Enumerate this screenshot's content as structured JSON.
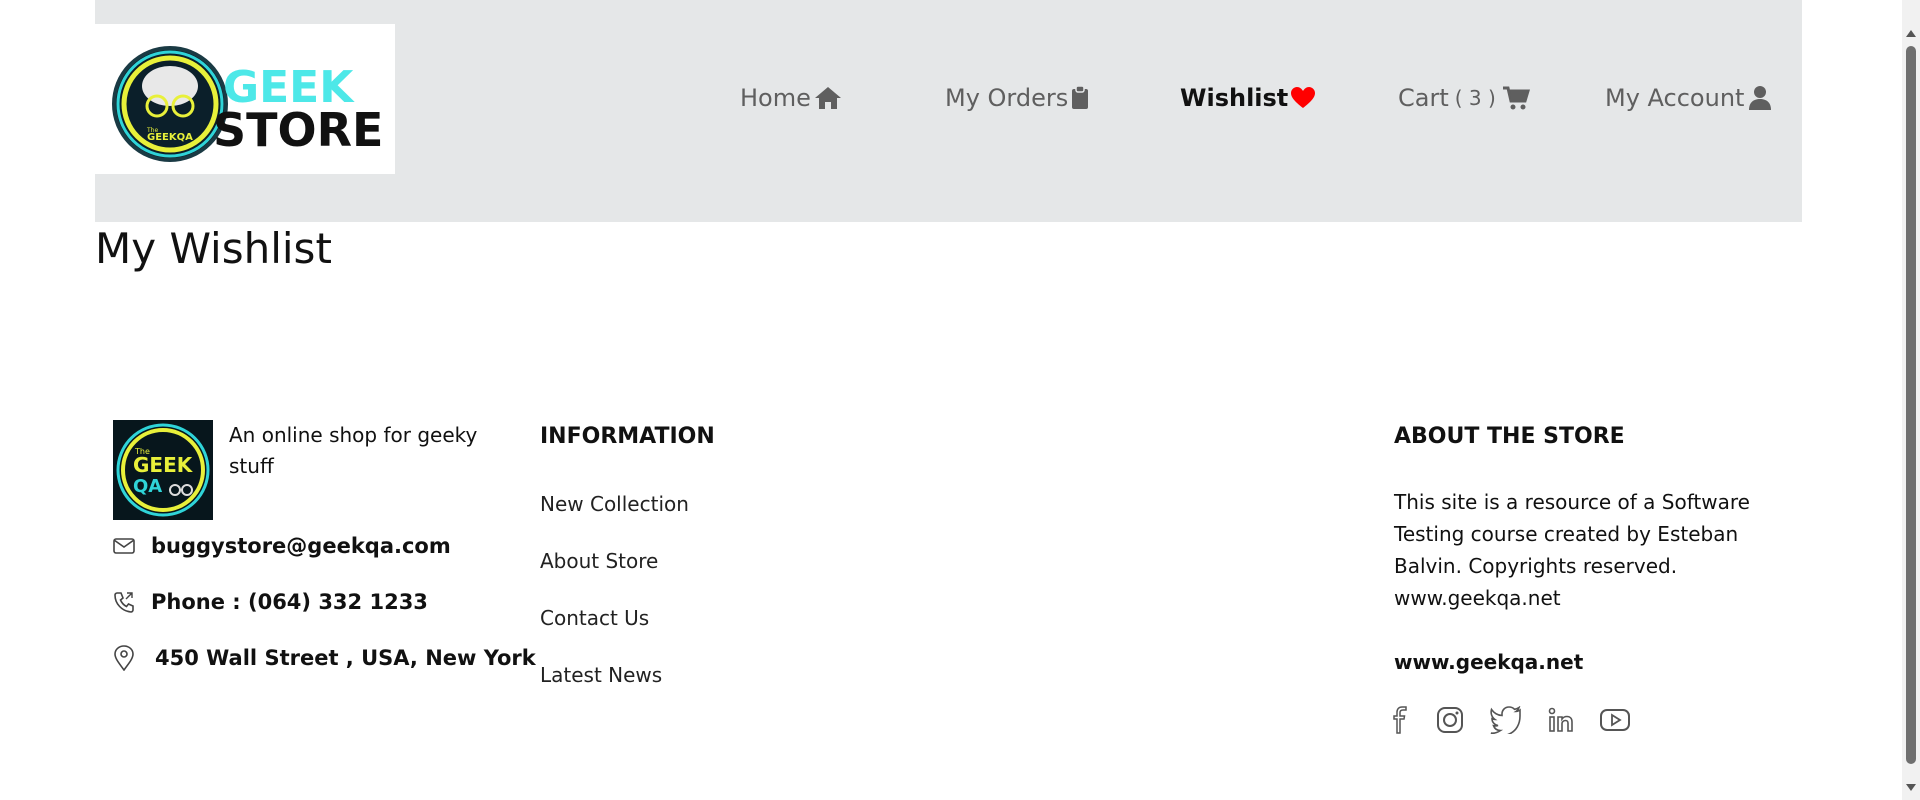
{
  "header": {
    "logo": {
      "word1": "GEEK",
      "word2": "STORE",
      "badge": "GEEKQA",
      "badge_small": "The"
    },
    "nav": [
      {
        "label": "Home",
        "icon": "home-icon"
      },
      {
        "label": "My Orders",
        "icon": "clipboard-icon"
      },
      {
        "label": "Wishlist",
        "icon": "heart-icon",
        "active": true
      },
      {
        "label": "Cart",
        "count": "( 3 )",
        "icon": "cart-icon"
      },
      {
        "label": "My Account",
        "icon": "user-icon"
      }
    ]
  },
  "main": {
    "title": "My Wishlist"
  },
  "footer": {
    "logo": {
      "line1": "GEEK",
      "line2": "QA",
      "small": "The"
    },
    "tagline": "An online shop for geeky stuff",
    "email": "buggystore@geekqa.com",
    "phone": "Phone : (064) 332 1233",
    "address": "450 Wall Street , USA, New York",
    "information": {
      "heading": "INFORMATION",
      "links": [
        "New Collection",
        "About Store",
        "Contact Us",
        "Latest News"
      ]
    },
    "about": {
      "heading": "ABOUT THE STORE",
      "text": "This site is a resource of a Software Testing course created by Esteban Balvin. Copyrights reserved. www.geekqa.net",
      "site": "www.geekqa.net"
    },
    "socials": [
      "facebook-icon",
      "instagram-icon",
      "twitter-icon",
      "linkedin-icon",
      "youtube-icon"
    ]
  },
  "colors": {
    "header_bg": "#e5e7e8",
    "nav_text": "#5f5f5f",
    "heart": "#ff0000",
    "logo_cyan": "#4de8e8",
    "logo_ring": "#e8f03a"
  }
}
